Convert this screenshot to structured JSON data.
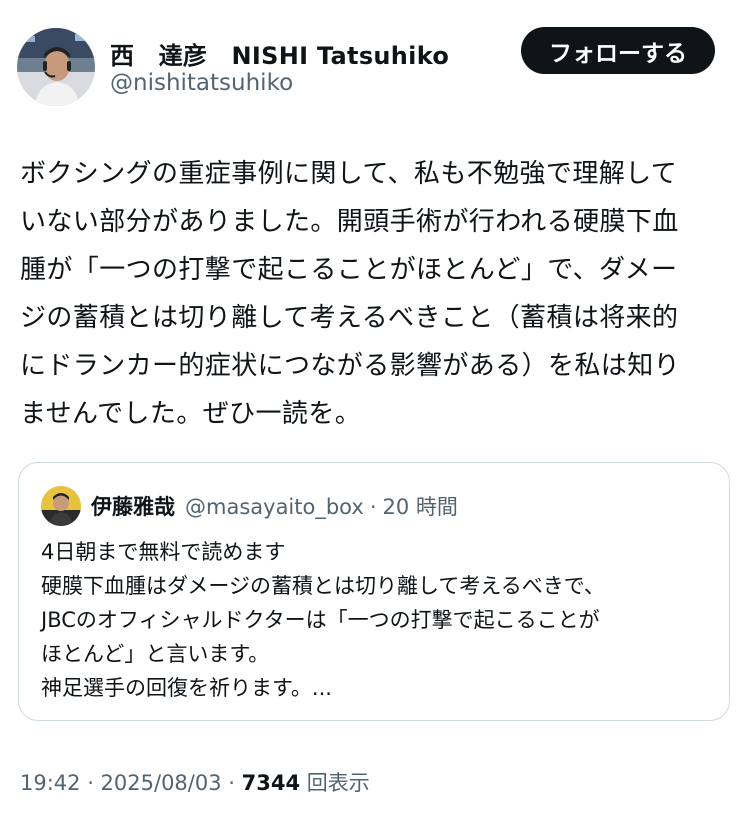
{
  "author": {
    "name": "西　達彦　NISHI Tatsuhiko",
    "handle": "@nishitatsuhiko",
    "avatar_icon": "author-avatar"
  },
  "follow_label": "フォローする",
  "post": {
    "lines": [
      "ボクシングの重症事例に関して、私も不勉強で理解して",
      "いない部分がありました。開頭手術が行われる硬膜下血",
      "腫が「一つの打撃で起こることがほとんど」で、ダメー",
      "ジの蓄積とは切り離して考えるべきこと（蓄積は将来的",
      "にドランカー的症状につながる影響がある）を私は知り",
      "ませんでした。ぜひ一読を。"
    ]
  },
  "quote": {
    "name": "伊藤雅哉",
    "handle": "@masayaito_box",
    "separator": "·",
    "time": "20 時間",
    "avatar_icon": "quote-author-avatar",
    "lines": [
      "4日朝まで無料で読めます",
      "硬膜下血腫はダメージの蓄積とは切り離して考えるべきで、",
      "JBCのオフィシャルドクターは「一つの打撃で起こることが",
      "ほとんど」と言います。",
      "神足選手の回復を祈ります。..."
    ]
  },
  "meta": {
    "timestamp": "19:42 · 2025/08/03 · ",
    "views_count": "7344",
    "views_label": " 回表示"
  },
  "colors": {
    "text": "#0f1419",
    "secondary": "#536471",
    "border": "#cfd9de",
    "follow_bg": "#0f1419"
  }
}
